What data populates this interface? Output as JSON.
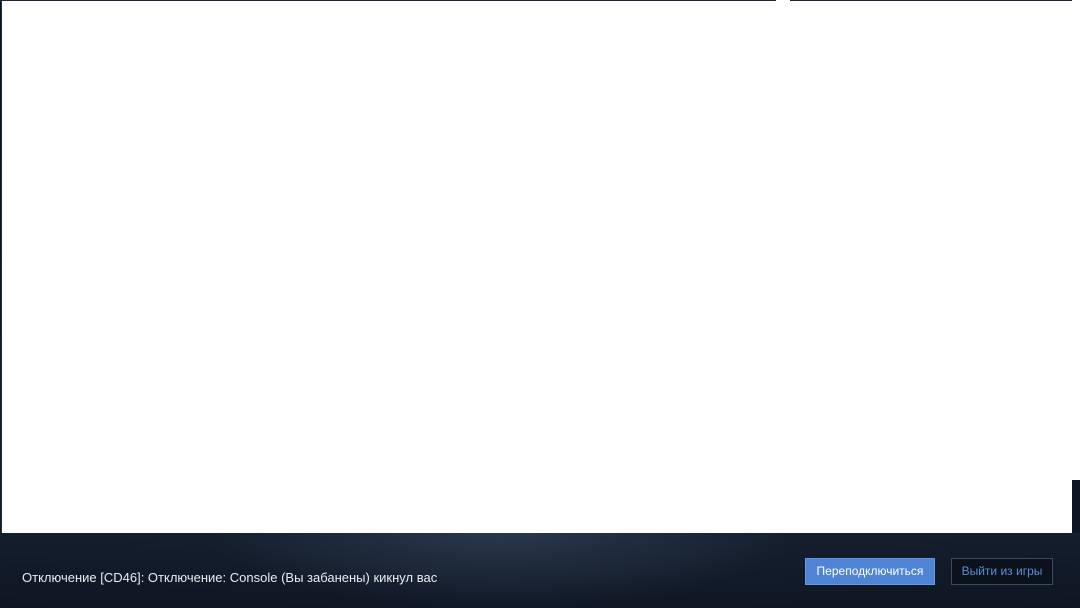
{
  "disconnect": {
    "message": "Отключение [CD46]: Отключение: Console (Вы забанены) кикнул вас"
  },
  "actions": {
    "reconnect_label": "Переподключиться",
    "quit_label": "Выйти из игры"
  },
  "colors": {
    "accent": "#4f83d4",
    "quit_text": "#5b8ed8",
    "background": "#0c1420"
  }
}
